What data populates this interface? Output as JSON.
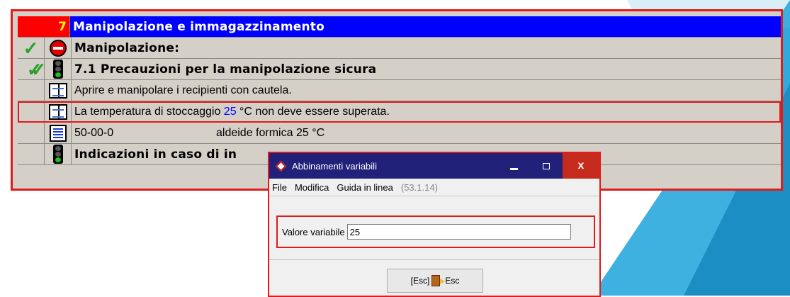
{
  "sheet": {
    "section_number": "7",
    "section_title": "Manipolazione e immagazzinamento",
    "rows": [
      {
        "text": "Manipolazione:"
      },
      {
        "text": "7.1 Precauzioni per la manipolazione sicura"
      },
      {
        "text": "Aprire e manipolare i recipienti con cautela."
      },
      {
        "text_before": "La temperatura di stoccaggio ",
        "value": "25",
        "text_after": " °C non deve essere superata."
      },
      {
        "col1": "50-00-0",
        "col2": "aldeide formica  25 °C"
      },
      {
        "text": "Indicazioni in caso di in"
      }
    ],
    "icons": {
      "check": "check-icon",
      "stop": "stop-icon",
      "traffic_light": "traffic-light-icon",
      "book": "book-icon",
      "list": "list-icon"
    }
  },
  "dialog": {
    "title": "Abbinamenti variabili",
    "minimize_symbol": "",
    "maximize_symbol": "",
    "close_symbol": "x",
    "menu": {
      "file": "File",
      "modifica": "Modifica",
      "guida": "Guida in linea",
      "version": "(53.1.14)"
    },
    "field_label": "Valore variabile",
    "field_value": "25",
    "esc_prefix": "[Esc]",
    "esc_label": "Esc"
  },
  "colors": {
    "highlight": "#e01b1b",
    "header_blue": "#0000ff",
    "header_red": "#ff0000",
    "titlebar": "#21217a"
  }
}
